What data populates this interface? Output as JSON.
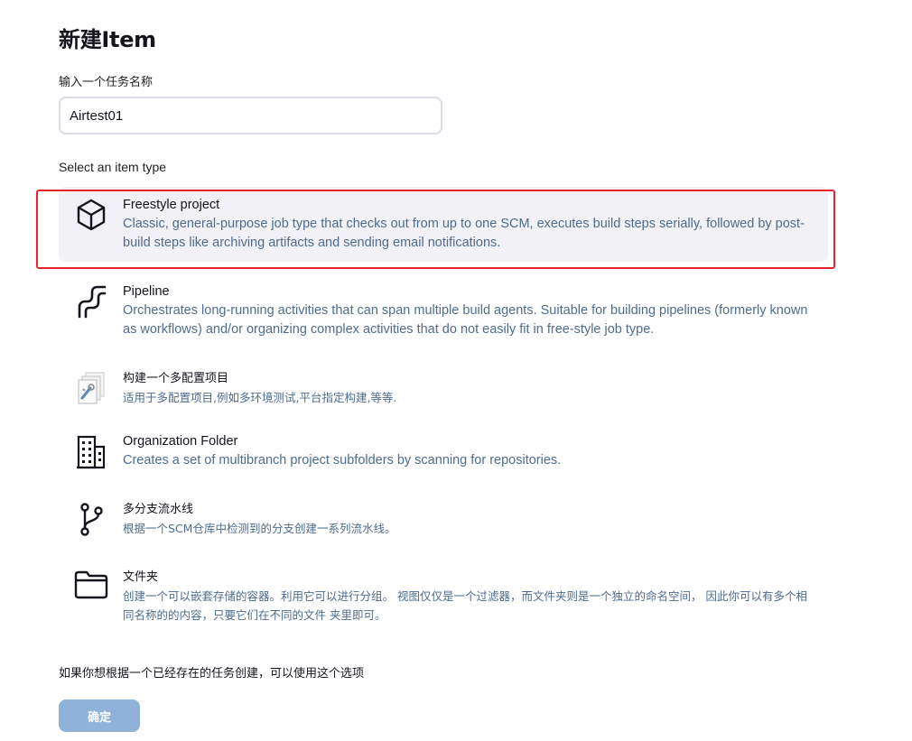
{
  "page": {
    "title": "新建Item",
    "name_label": "输入一个任务名称",
    "name_value": "Airtest01",
    "type_label": "Select an item type",
    "copy_label": "如果你想根据一个已经存在的任务创建，可以使用这个选项",
    "ok_label": "确定"
  },
  "items": [
    {
      "title": "Freestyle project",
      "desc": "Classic, general-purpose job type that checks out from up to one SCM, executes build steps serially, followed by post-build steps like archiving artifacts and sending email notifications.",
      "icon": "cube-icon",
      "selected": true
    },
    {
      "title": "Pipeline",
      "desc": "Orchestrates long-running activities that can span multiple build agents. Suitable for building pipelines (formerly known as workflows) and/or organizing complex activities that do not easily fit in free-style job type.",
      "icon": "pipeline-icon",
      "selected": false
    },
    {
      "title": "构建一个多配置项目",
      "desc": "适用于多配置项目,例如多环境测试,平台指定构建,等等.",
      "icon": "multi-config-icon",
      "selected": false
    },
    {
      "title": "Organization Folder",
      "desc": "Creates a set of multibranch project subfolders by scanning for repositories.",
      "icon": "building-icon",
      "selected": false
    },
    {
      "title": "多分支流水线",
      "desc": "根据一个SCM仓库中检测到的分支创建一系列流水线。",
      "icon": "branch-icon",
      "selected": false
    },
    {
      "title": "文件夹",
      "desc": "创建一个可以嵌套存储的容器。利用它可以进行分组。 视图仅仅是一个过滤器，而文件夹则是一个独立的命名空间， 因此你可以有多个相同名称的的内容，只要它们在不同的文件 夹里即可。",
      "icon": "folder-icon",
      "selected": false
    }
  ],
  "colors": {
    "highlight": "#e8232b",
    "desc_text": "#4d6c8e",
    "selected_bg": "#f1f1f6",
    "ok_button": "#8fb2d9"
  }
}
